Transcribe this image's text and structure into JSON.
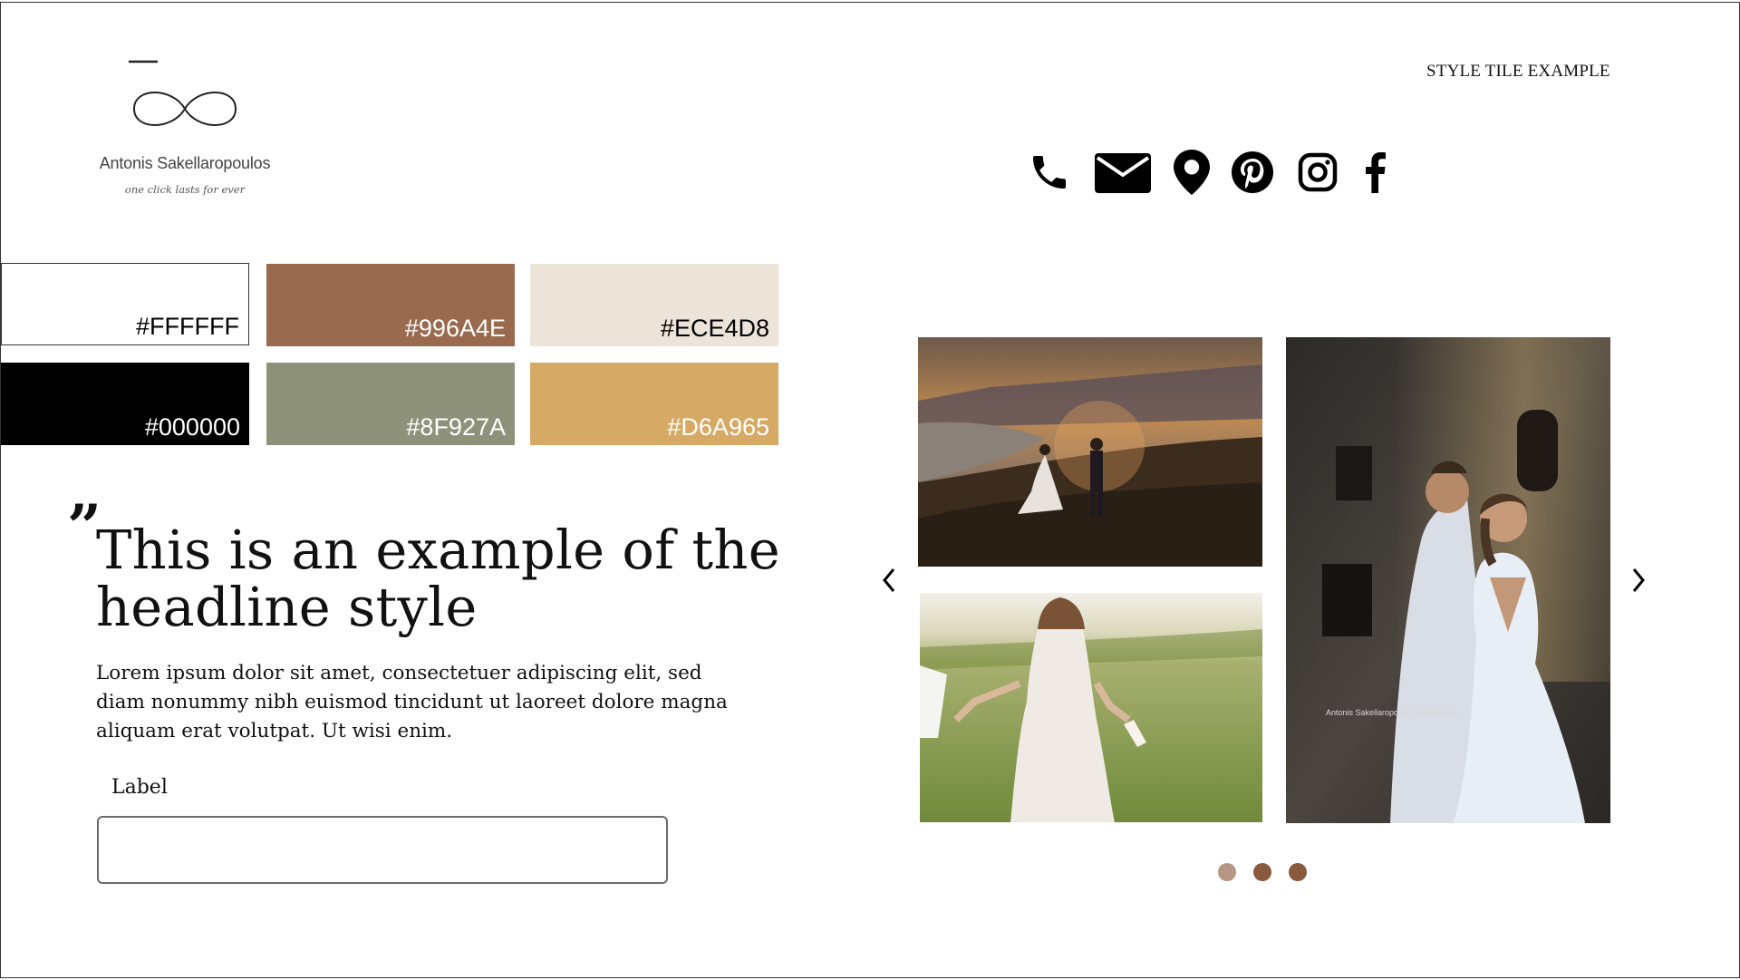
{
  "brand": {
    "name": "Antonis Sakellaropoulos",
    "tagline": "one click lasts for ever"
  },
  "header": {
    "title": "STYLE TILE EXAMPLE"
  },
  "social_icons": [
    "phone-icon",
    "mail-icon",
    "location-pin-icon",
    "pinterest-icon",
    "instagram-icon",
    "facebook-icon"
  ],
  "palette": [
    {
      "hex": "#FFFFFF",
      "label": "#FFFFFF"
    },
    {
      "hex": "#996A4E",
      "label": "#996A4E"
    },
    {
      "hex": "#ECE4D8",
      "label": "#ECE4D8"
    },
    {
      "hex": "#000000",
      "label": "#000000"
    },
    {
      "hex": "#8F927A",
      "label": "#8F927A"
    },
    {
      "hex": "#D6A965",
      "label": "#D6A965"
    }
  ],
  "content": {
    "headline": "This is an example of the headline style",
    "body": "Lorem ipsum dolor sit amet, consectetuer adipiscing elit, sed diam nonummy nibh euismod tincidunt ut laoreet dolore magna aliquam erat volutpat. Ut wisi enim.",
    "field_label": "Label",
    "field_value": ""
  },
  "gallery": {
    "photos": [
      "sunset-couple-photo",
      "bride-on-grass-photo",
      "couple-embrace-photo"
    ],
    "watermark": "Antonis Sakellaropoulos photography",
    "dots": [
      "#B59684",
      "#8A5A3E",
      "#8A5A3E"
    ]
  }
}
